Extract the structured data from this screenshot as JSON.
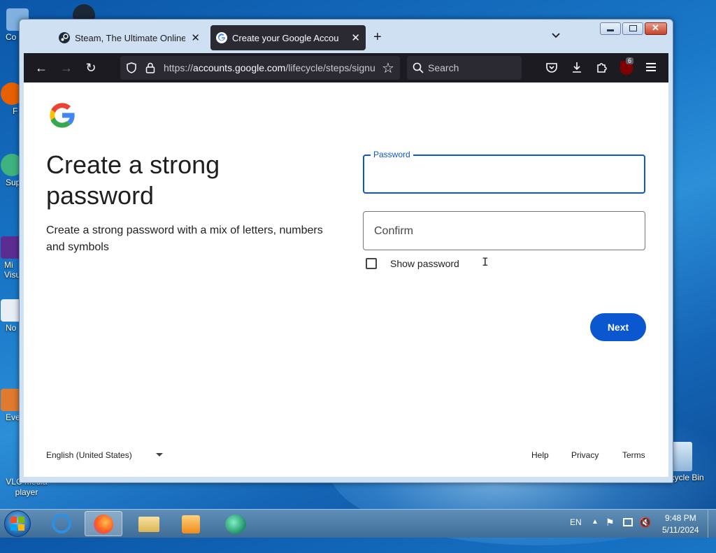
{
  "desktop": {
    "icons": [
      {
        "label": "Co"
      },
      {
        "label": "F"
      },
      {
        "label": "Sup"
      },
      {
        "label": "Mi Visu"
      },
      {
        "label": "No"
      },
      {
        "label": "Eve"
      },
      {
        "label": "VLC media player"
      },
      {
        "label": "Recycle Bin"
      }
    ]
  },
  "browser": {
    "tabs": [
      {
        "title": "Steam, The Ultimate Online Game",
        "active": false
      },
      {
        "title": "Create your Google Account",
        "active": true
      }
    ],
    "new_tab": "+",
    "url_prefix": "https://",
    "url_domain": "accounts.google.com",
    "url_path": "/lifecycle/steps/signup",
    "search_placeholder": "Search",
    "extension_badge": "6"
  },
  "page": {
    "heading": "Create a strong password",
    "subtitle": "Create a strong password with a mix of letters, numbers and symbols",
    "password_label": "Password",
    "password_value": "",
    "confirm_placeholder": "Confirm",
    "show_password_label": "Show password",
    "show_password_checked": false,
    "next_label": "Next",
    "language": "English (United States)",
    "footer": {
      "help": "Help",
      "privacy": "Privacy",
      "terms": "Terms"
    }
  },
  "taskbar": {
    "lang": "EN",
    "time": "9:48 PM",
    "date": "5/11/2024"
  },
  "colors": {
    "google_blue": "#0b57d0",
    "browser_dark": "#1c1b22",
    "desktop_blue": "#1a78c9"
  }
}
